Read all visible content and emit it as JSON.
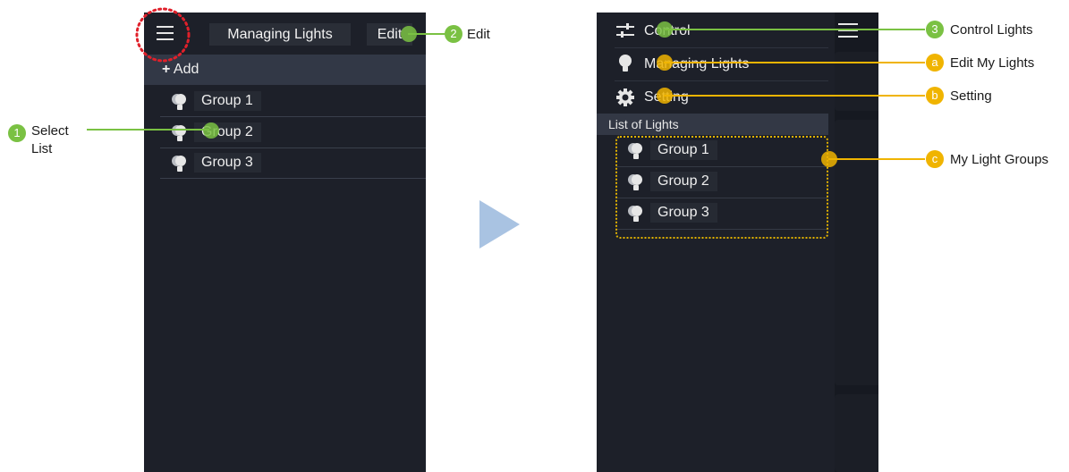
{
  "left_screen": {
    "header": {
      "title": "Managing Lights",
      "edit_label": "Edit"
    },
    "add_label": "Add",
    "add_prefix": "+",
    "groups": [
      {
        "label": "Group 1"
      },
      {
        "label": "Group 2"
      },
      {
        "label": "Group 3"
      }
    ]
  },
  "right_screen": {
    "drawer": {
      "items": [
        {
          "label": "Control",
          "icon": "sliders-icon"
        },
        {
          "label": "Managing Lights",
          "icon": "bulb-icon"
        },
        {
          "label": "Setting",
          "icon": "gear-icon"
        }
      ],
      "list_header": "List of Lights",
      "groups": [
        {
          "label": "Group 1"
        },
        {
          "label": "Group 2"
        },
        {
          "label": "Group 3"
        }
      ]
    }
  },
  "callouts": {
    "step1": {
      "number": "1",
      "text_line1": "Select",
      "text_line2": "List"
    },
    "step2": {
      "number": "2",
      "text": "Edit"
    },
    "step3": {
      "number": "3",
      "text": "Control Lights"
    },
    "a": {
      "letter": "a",
      "text": "Edit My Lights"
    },
    "b": {
      "letter": "b",
      "text": "Setting"
    },
    "c": {
      "letter": "c",
      "text": "My Light Groups"
    }
  },
  "colors": {
    "app_background": "#1d2029",
    "callout_green": "#7ac143",
    "callout_orange": "#f0b400",
    "highlight_red": "#e0202a",
    "transition_arrow": "#a9c3e2"
  }
}
